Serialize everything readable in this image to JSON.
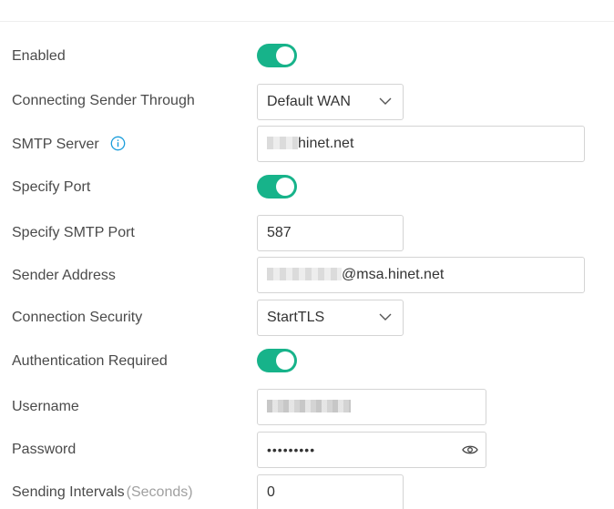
{
  "form": {
    "enabled": {
      "label": "Enabled",
      "on": true
    },
    "connecting_through": {
      "label": "Connecting Sender Through",
      "value": "Default WAN"
    },
    "smtp_server": {
      "label": "SMTP Server",
      "value_visible": "hinet.net",
      "info_icon": "info-circle-icon"
    },
    "specify_port": {
      "label": "Specify Port",
      "on": true
    },
    "smtp_port": {
      "label": "Specify SMTP Port",
      "value": "587"
    },
    "sender_address": {
      "label": "Sender Address",
      "value_visible": "@msa.hinet.net"
    },
    "connection_security": {
      "label": "Connection Security",
      "value": "StartTLS"
    },
    "auth_required": {
      "label": "Authentication Required",
      "on": true
    },
    "username": {
      "label": "Username"
    },
    "password": {
      "label": "Password",
      "masked": "•••••••••",
      "eye_icon": "eye-icon"
    },
    "sending_intervals": {
      "label": "Sending Intervals",
      "unit": "(Seconds)",
      "value": "0"
    }
  },
  "colors": {
    "toggle_on": "#17b38a",
    "info_icon": "#1a9ddb",
    "border": "#d4d4d4",
    "label": "#4a4a4a"
  }
}
